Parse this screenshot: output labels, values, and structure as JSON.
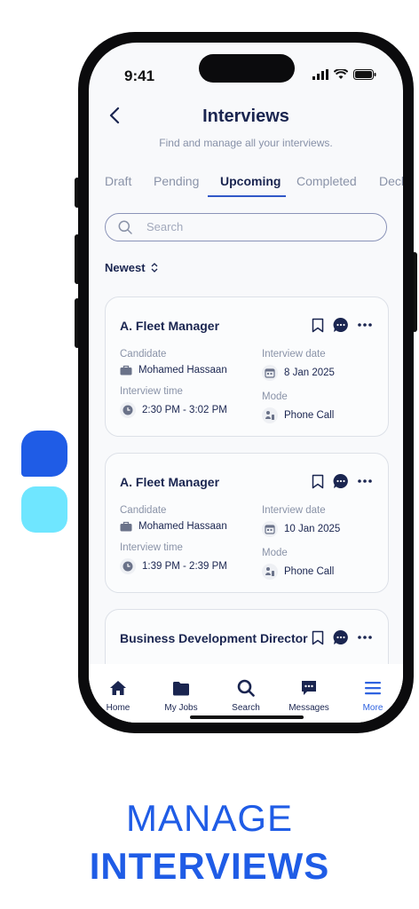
{
  "status": {
    "time": "9:41"
  },
  "header": {
    "title": "Interviews",
    "subtitle": "Find and manage all your interviews."
  },
  "tabs": [
    {
      "label": "Draft"
    },
    {
      "label": "Pending"
    },
    {
      "label": "Upcoming"
    },
    {
      "label": "Completed"
    },
    {
      "label": "Decl"
    }
  ],
  "active_tab": "Upcoming",
  "search": {
    "placeholder": "Search",
    "value": ""
  },
  "sort": {
    "label": "Newest"
  },
  "labels": {
    "candidate": "Candidate",
    "interview_date": "Interview date",
    "interview_time": "Interview time",
    "mode": "Mode"
  },
  "cards": [
    {
      "title": "A. Fleet Manager",
      "candidate": "Mohamed Hassaan",
      "date": "8 Jan 2025",
      "time": "2:30 PM - 3:02 PM",
      "mode": "Phone Call"
    },
    {
      "title": "A. Fleet Manager",
      "candidate": "Mohamed Hassaan",
      "date": "10 Jan 2025",
      "time": "1:39 PM - 2:39 PM",
      "mode": "Phone Call"
    },
    {
      "title": "Business Development Director"
    }
  ],
  "tabbar": [
    {
      "label": "Home",
      "icon": "home-icon"
    },
    {
      "label": "My Jobs",
      "icon": "folder-icon"
    },
    {
      "label": "Search",
      "icon": "search-icon"
    },
    {
      "label": "Messages",
      "icon": "message-icon"
    },
    {
      "label": "More",
      "icon": "menu-icon"
    }
  ],
  "tagline": {
    "line1": "MANAGE",
    "line2": "INTERVIEWS"
  },
  "colors": {
    "accent": "#1f5ce6",
    "cyan": "#6fe6ff",
    "navy": "#1a2550"
  }
}
